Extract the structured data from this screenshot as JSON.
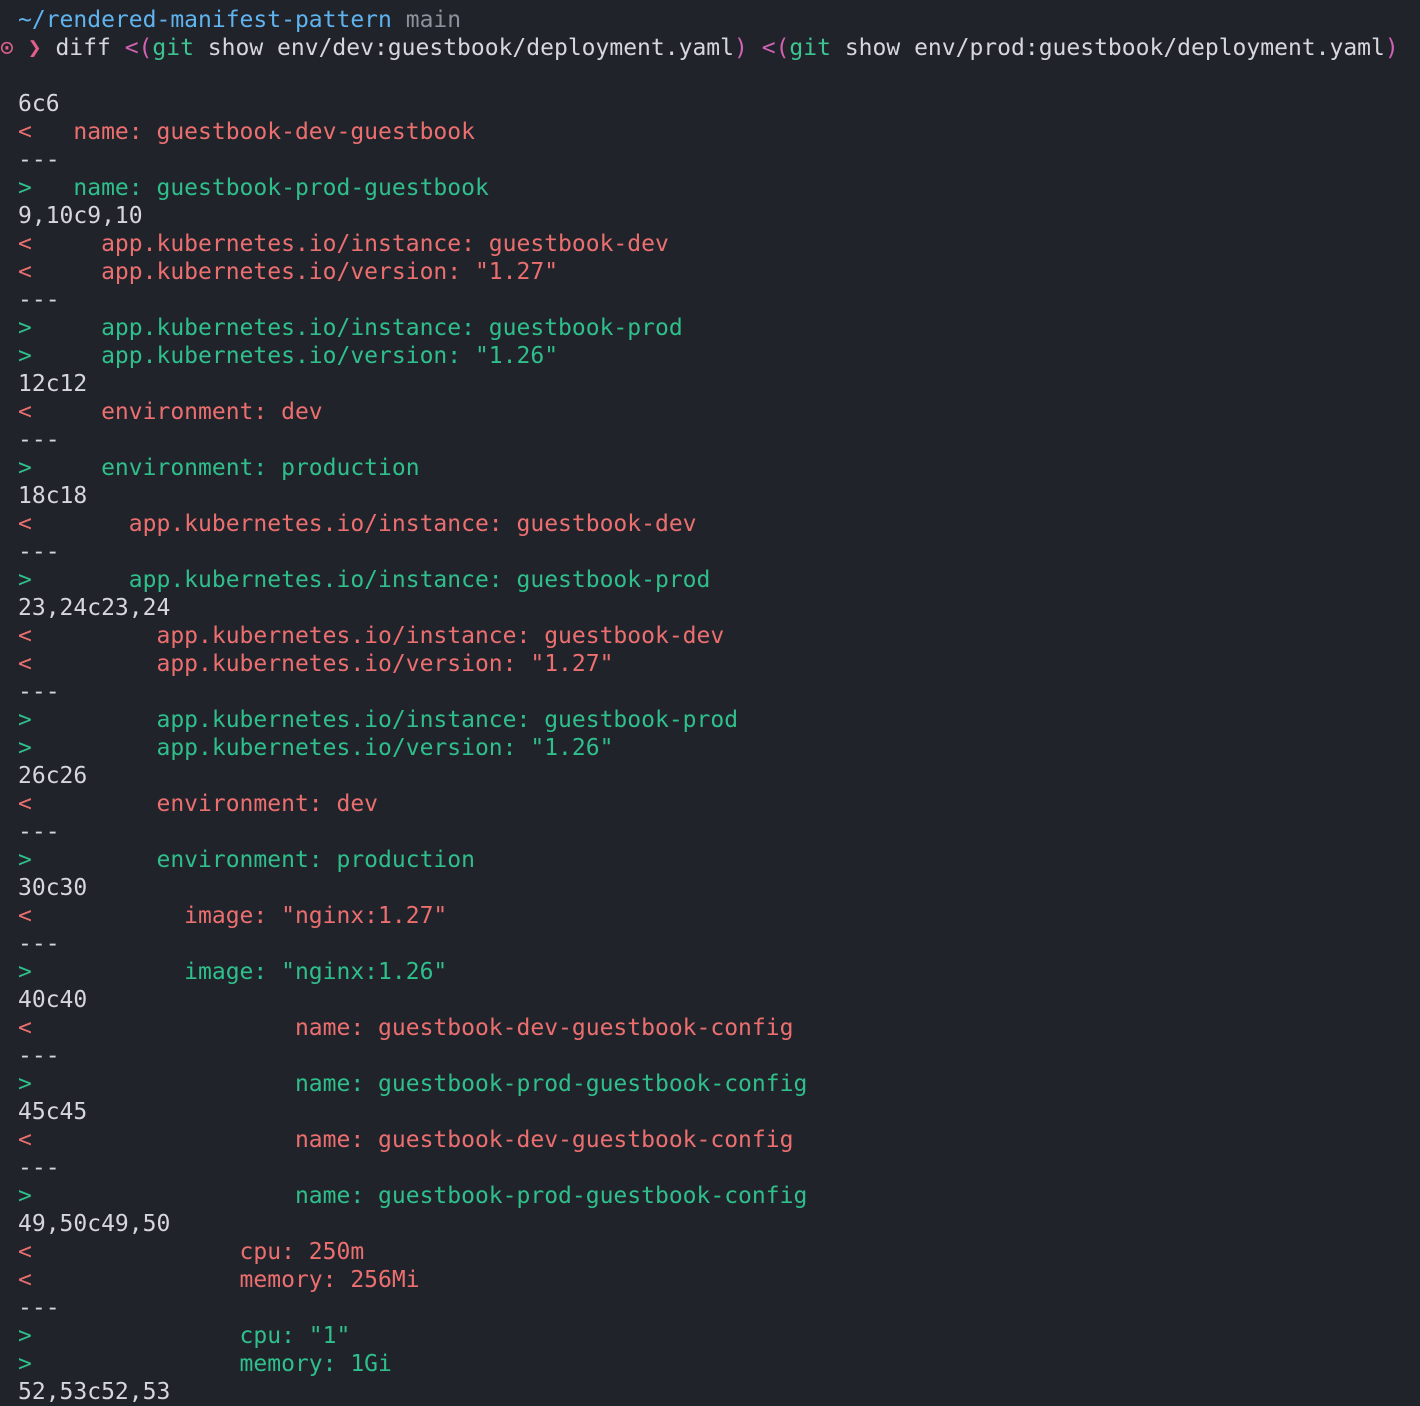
{
  "colors": {
    "background": "#21232b",
    "removed": "#ec6f6f",
    "added": "#2fbf8b",
    "path": "#5fb4ef",
    "branch": "#8d9199",
    "prompt": "#e0608a"
  },
  "prompt": {
    "cwd": "~/rendered-manifest-pattern",
    "branch": "main",
    "status_icon": "⊙",
    "chevron": "❯",
    "command": {
      "diff": "diff",
      "sub1_open": "<(",
      "git1": "git",
      "args1": "show env/dev:guestbook/deployment.yaml",
      "sub1_close": ")",
      "sub2_open": "<(",
      "git2": "git",
      "args2": "show env/prod:guestbook/deployment.yaml",
      "sub2_close": ")"
    }
  },
  "output": [
    {
      "type": "blank",
      "text": ""
    },
    {
      "type": "hunk",
      "text": "6c6"
    },
    {
      "type": "del",
      "text": "<   name: guestbook-dev-guestbook"
    },
    {
      "type": "sep",
      "text": "---"
    },
    {
      "type": "add",
      "text": ">   name: guestbook-prod-guestbook"
    },
    {
      "type": "hunk",
      "text": "9,10c9,10"
    },
    {
      "type": "del",
      "text": "<     app.kubernetes.io/instance: guestbook-dev"
    },
    {
      "type": "del",
      "text": "<     app.kubernetes.io/version: \"1.27\""
    },
    {
      "type": "sep",
      "text": "---"
    },
    {
      "type": "add",
      "text": ">     app.kubernetes.io/instance: guestbook-prod"
    },
    {
      "type": "add",
      "text": ">     app.kubernetes.io/version: \"1.26\""
    },
    {
      "type": "hunk",
      "text": "12c12"
    },
    {
      "type": "del",
      "text": "<     environment: dev"
    },
    {
      "type": "sep",
      "text": "---"
    },
    {
      "type": "add",
      "text": ">     environment: production"
    },
    {
      "type": "hunk",
      "text": "18c18"
    },
    {
      "type": "del",
      "text": "<       app.kubernetes.io/instance: guestbook-dev"
    },
    {
      "type": "sep",
      "text": "---"
    },
    {
      "type": "add",
      "text": ">       app.kubernetes.io/instance: guestbook-prod"
    },
    {
      "type": "hunk",
      "text": "23,24c23,24"
    },
    {
      "type": "del",
      "text": "<         app.kubernetes.io/instance: guestbook-dev"
    },
    {
      "type": "del",
      "text": "<         app.kubernetes.io/version: \"1.27\""
    },
    {
      "type": "sep",
      "text": "---"
    },
    {
      "type": "add",
      "text": ">         app.kubernetes.io/instance: guestbook-prod"
    },
    {
      "type": "add",
      "text": ">         app.kubernetes.io/version: \"1.26\""
    },
    {
      "type": "hunk",
      "text": "26c26"
    },
    {
      "type": "del",
      "text": "<         environment: dev"
    },
    {
      "type": "sep",
      "text": "---"
    },
    {
      "type": "add",
      "text": ">         environment: production"
    },
    {
      "type": "hunk",
      "text": "30c30"
    },
    {
      "type": "del",
      "text": "<           image: \"nginx:1.27\""
    },
    {
      "type": "sep",
      "text": "---"
    },
    {
      "type": "add",
      "text": ">           image: \"nginx:1.26\""
    },
    {
      "type": "hunk",
      "text": "40c40"
    },
    {
      "type": "del",
      "text": "<                   name: guestbook-dev-guestbook-config"
    },
    {
      "type": "sep",
      "text": "---"
    },
    {
      "type": "add",
      "text": ">                   name: guestbook-prod-guestbook-config"
    },
    {
      "type": "hunk",
      "text": "45c45"
    },
    {
      "type": "del",
      "text": "<                   name: guestbook-dev-guestbook-config"
    },
    {
      "type": "sep",
      "text": "---"
    },
    {
      "type": "add",
      "text": ">                   name: guestbook-prod-guestbook-config"
    },
    {
      "type": "hunk",
      "text": "49,50c49,50"
    },
    {
      "type": "del",
      "text": "<               cpu: 250m"
    },
    {
      "type": "del",
      "text": "<               memory: 256Mi"
    },
    {
      "type": "sep",
      "text": "---"
    },
    {
      "type": "add",
      "text": ">               cpu: \"1\""
    },
    {
      "type": "add",
      "text": ">               memory: 1Gi"
    },
    {
      "type": "hunk",
      "text": "52,53c52,53"
    }
  ]
}
